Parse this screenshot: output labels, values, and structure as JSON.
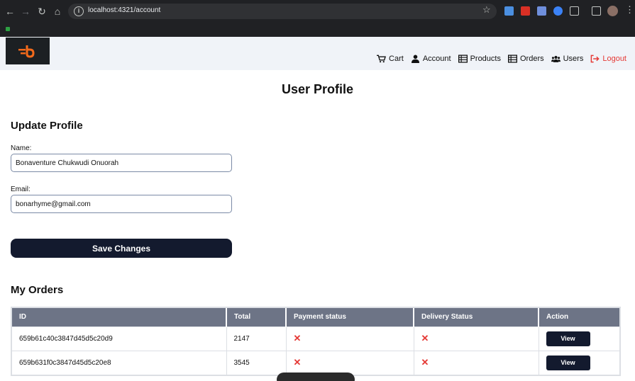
{
  "browser": {
    "url": "localhost:4321/account"
  },
  "header": {
    "nav": [
      {
        "label": "Cart",
        "icon": "cart-icon"
      },
      {
        "label": "Account",
        "icon": "user-icon"
      },
      {
        "label": "Products",
        "icon": "table-icon"
      },
      {
        "label": "Orders",
        "icon": "table-icon"
      },
      {
        "label": "Users",
        "icon": "users-icon"
      },
      {
        "label": "Logout",
        "icon": "logout-icon"
      }
    ],
    "logout_color": "#e53935"
  },
  "page": {
    "title": "User Profile"
  },
  "profile_form": {
    "title": "Update Profile",
    "name_label": "Name:",
    "name_value": "Bonaventure Chukwudi Onuorah",
    "email_label": "Email:",
    "email_value": "bonarhyme@gmail.com",
    "save_label": "Save Changes"
  },
  "orders": {
    "title": "My Orders",
    "columns": [
      "ID",
      "Total",
      "Payment status",
      "Delivery Status",
      "Action"
    ],
    "rows": [
      {
        "id": "659b61c40c3847d45d5c20d9",
        "total": "2147",
        "payment": "✕",
        "delivery": "✕",
        "action": "View"
      },
      {
        "id": "659b631f0c3847d45d5c20e8",
        "total": "3545",
        "payment": "✕",
        "delivery": "✕",
        "action": "View"
      }
    ]
  },
  "colors": {
    "accent_dark": "#131a2e",
    "header_bg": "#f0f3f8",
    "table_header": "#6d7486",
    "status_false": "#e53935"
  }
}
